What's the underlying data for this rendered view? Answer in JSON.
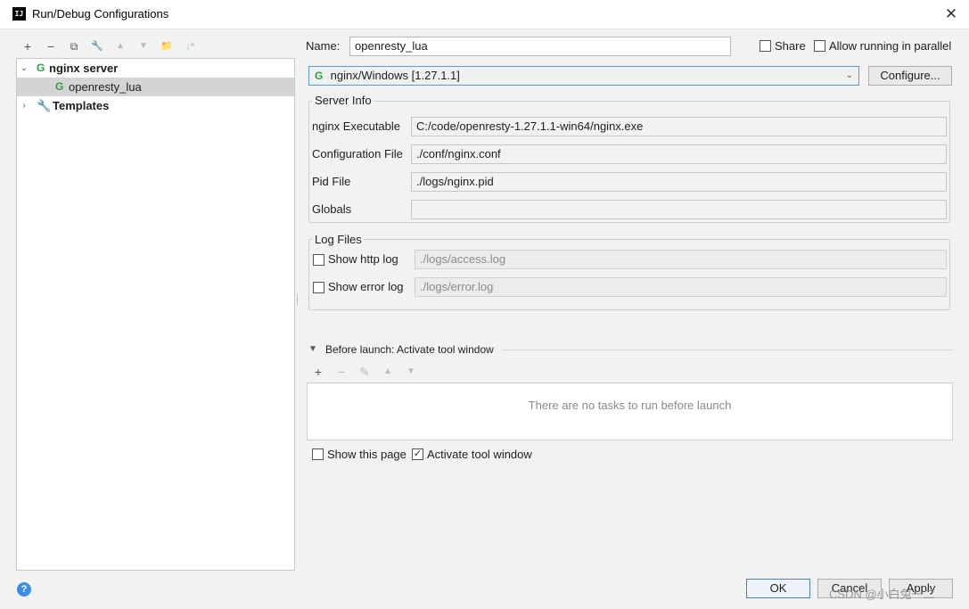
{
  "window": {
    "title": "Run/Debug Configurations",
    "app_icon": "IJ",
    "close_glyph": "✕"
  },
  "left_toolbar": {
    "add": "+",
    "remove": "−",
    "copy": "⧉",
    "edit": "🔧",
    "up": "▲",
    "down": "▼",
    "folder": "📁",
    "sort": "↓ª"
  },
  "tree": {
    "items": [
      {
        "label": "nginx server",
        "expanded": true
      },
      {
        "label": "openresty_lua",
        "selected": true
      },
      {
        "label": "Templates",
        "expanded": false
      }
    ]
  },
  "form": {
    "name_label": "Name:",
    "name_value": "openresty_lua",
    "share_label": "Share",
    "share_checked": false,
    "parallel_label": "Allow running in parallel",
    "parallel_checked": false,
    "server_select": "nginx/Windows [1.27.1.1]",
    "configure_label": "Configure..."
  },
  "server_info": {
    "title": "Server Info",
    "fields": [
      {
        "label": "nginx Executable",
        "value": "C:/code/openresty-1.27.1.1-win64/nginx.exe"
      },
      {
        "label": "Configuration File",
        "value": "./conf/nginx.conf"
      },
      {
        "label": "Pid File",
        "value": "./logs/nginx.pid"
      },
      {
        "label": "Globals",
        "value": ""
      }
    ]
  },
  "log_files": {
    "title": "Log Files",
    "http_label": "Show http log",
    "http_checked": false,
    "http_value": "./logs/access.log",
    "error_label": "Show error log",
    "error_checked": false,
    "error_value": "./logs/error.log"
  },
  "before_launch": {
    "title": "Before launch: Activate tool window",
    "empty_text": "There are no tasks to run before launch",
    "tools": {
      "add": "+",
      "remove": "−",
      "edit": "✎",
      "up": "▲",
      "down": "▼"
    },
    "show_page_label": "Show this page",
    "show_page_checked": false,
    "activate_label": "Activate tool window",
    "activate_checked": true
  },
  "buttons": {
    "ok": "OK",
    "cancel": "Cancel",
    "apply": "Apply",
    "help": "?"
  },
  "watermark": "CSDN @小白兔一二"
}
